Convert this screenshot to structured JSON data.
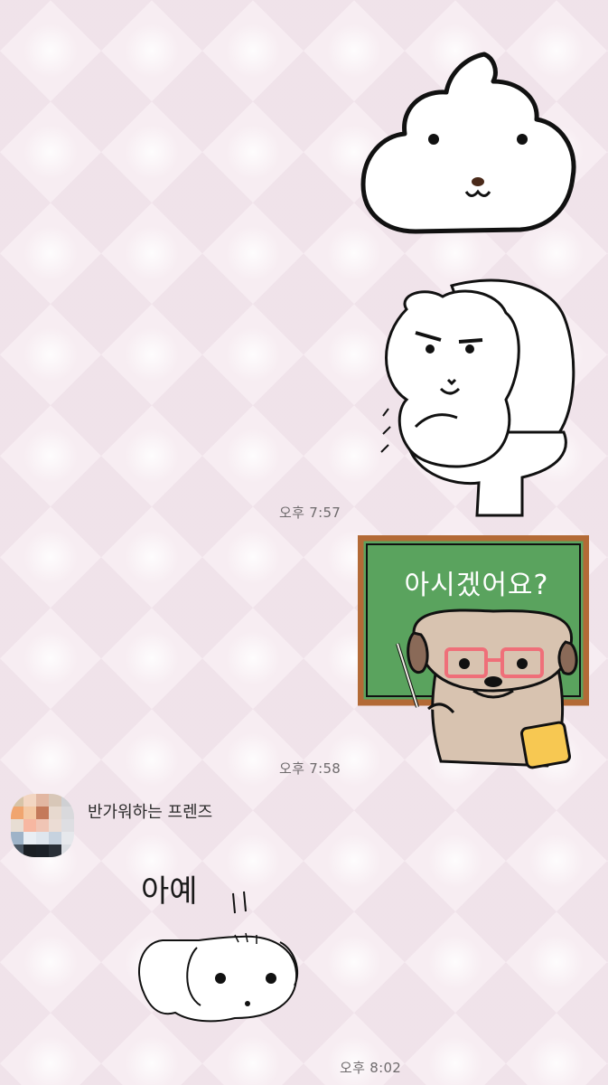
{
  "messages": [
    {
      "type": "sticker",
      "side": "right",
      "sticker": "white-poop-dog-sticker"
    },
    {
      "type": "sticker",
      "side": "right",
      "sticker": "toilet-hamster-sticker",
      "time": "오후 7:57"
    },
    {
      "type": "sticker",
      "side": "right",
      "sticker": "teacher-pug-sticker",
      "sticker_text": "아시겠어요?",
      "time": "오후 7:58"
    },
    {
      "type": "sticker",
      "side": "left",
      "sender": "반가워하는 프렌즈",
      "sticker": "bowing-dog-sticker",
      "sticker_text": "아예",
      "time": "오후 8:02"
    }
  ],
  "colors": {
    "background": "#f7edf2",
    "chalkboard": "#5aa35e",
    "chalkboard_frame": "#b36a36",
    "pug": "#d8c3b0",
    "glasses": "#ef6f79"
  }
}
